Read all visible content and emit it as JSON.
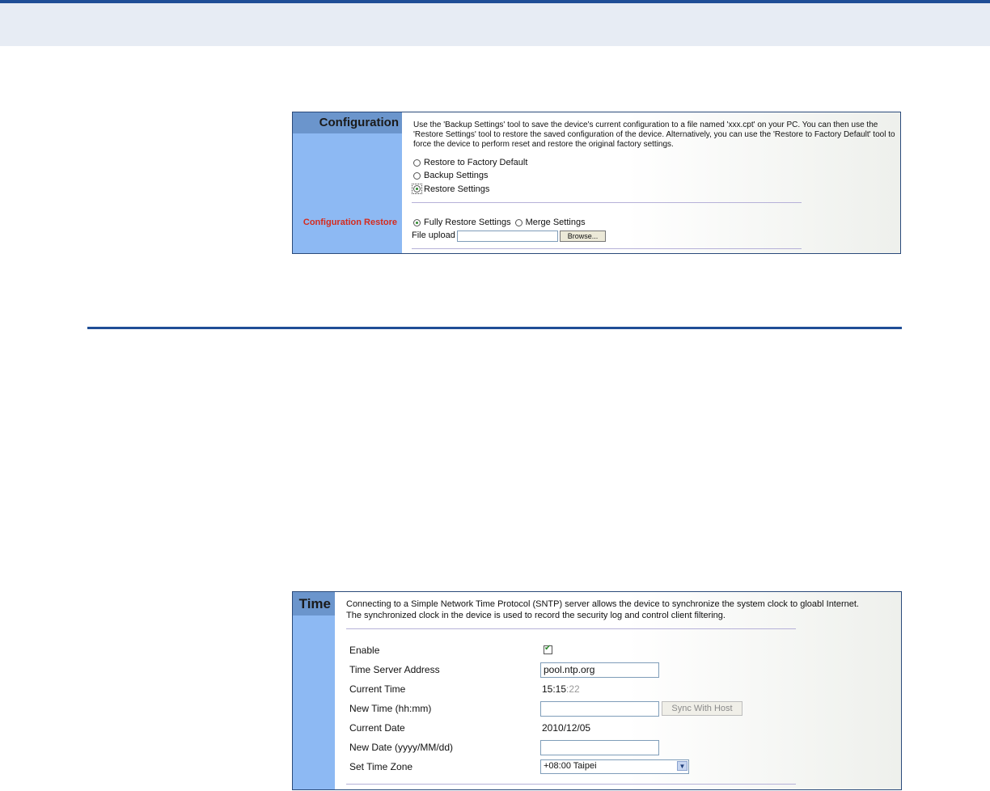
{
  "configuration": {
    "title": "Configuration",
    "description": "Use the 'Backup Settings' tool to save the device's current configuration to a file named 'xxx.cpt' on your PC. You can then use the 'Restore Settings' tool to restore the saved configuration of the device. Alternatively, you can use the 'Restore to Factory Default' tool to force the device to perform reset and restore the original factory settings.",
    "options": [
      {
        "label": "Restore to Factory Default",
        "selected": false
      },
      {
        "label": "Backup Settings",
        "selected": false
      },
      {
        "label": "Restore Settings",
        "selected": true
      }
    ],
    "restore_label": "Configuration Restore",
    "restore_modes": [
      {
        "label": "Fully Restore Settings",
        "selected": true
      },
      {
        "label": "Merge Settings",
        "selected": false
      }
    ],
    "file_upload_label": "File upload",
    "file_upload_value": "",
    "browse_label": "Browse..."
  },
  "time": {
    "title": "Time",
    "description_line1": "Connecting to a Simple Network Time Protocol (SNTP) server allows the device to synchronize the system clock to gloabl Internet.",
    "description_line2": "The synchronized clock in the device is used to record the security log and control client filtering.",
    "enable_label": "Enable",
    "enable_checked": true,
    "server_label": "Time Server Address",
    "server_value": "pool.ntp.org",
    "current_time_label": "Current Time",
    "current_time_hm": "15:15",
    "current_time_sec": ":22",
    "new_time_label": "New Time (hh:mm)",
    "new_time_value": "",
    "sync_label": "Sync With Host",
    "current_date_label": "Current Date",
    "current_date_value": "2010/12/05",
    "new_date_label": "New Date (yyyy/MM/dd)",
    "new_date_value": "",
    "timezone_label": "Set Time Zone",
    "timezone_value": "+08:00 Taipei"
  },
  "colors": {
    "brand_blue": "#1f4e96",
    "side_panel": "#8db9f3",
    "side_header": "#6b95cc",
    "restore_label_red": "#d52b1e"
  }
}
